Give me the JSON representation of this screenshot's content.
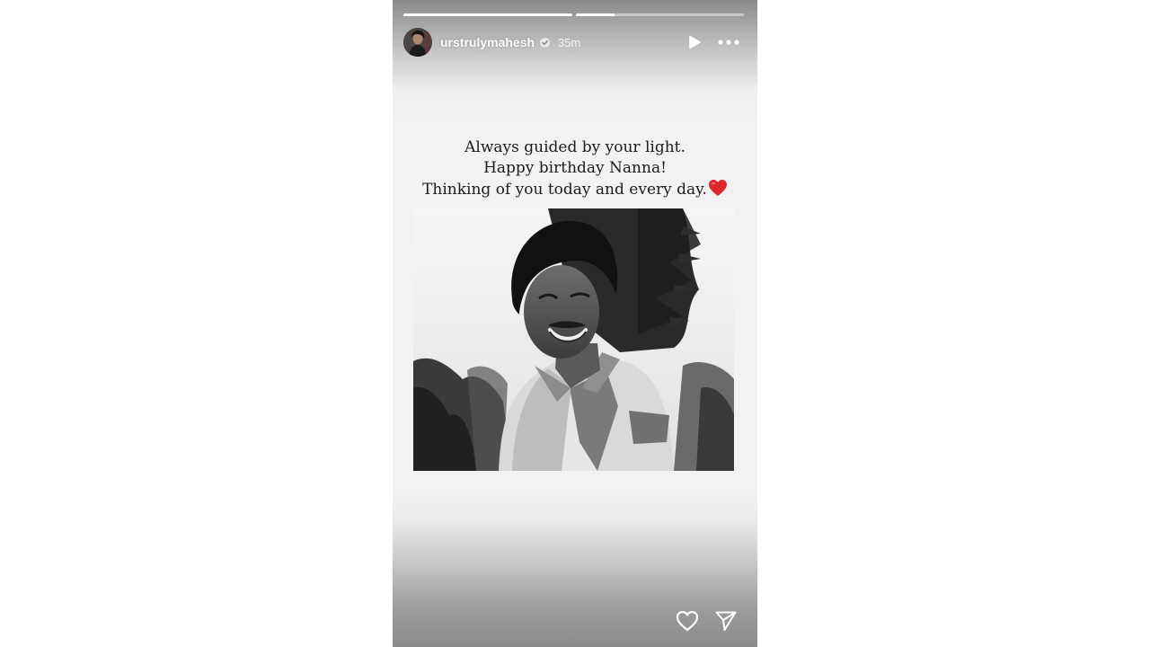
{
  "story": {
    "progress": [
      {
        "filled": 1.0
      },
      {
        "filled": 0.23
      }
    ],
    "header": {
      "username": "urstrulymahesh",
      "verified": true,
      "timestamp": "35m",
      "icons": [
        "play-icon",
        "more-options-icon"
      ]
    },
    "caption": {
      "line1": "Always guided by your light.",
      "line2": "Happy birthday Nanna!",
      "line3": "Thinking of you today and every day.",
      "emoji": "red-heart"
    },
    "photo": {
      "content": "black-and-white portrait"
    },
    "footer": {
      "icons": [
        "like-heart-icon",
        "share-send-icon"
      ]
    }
  },
  "colors": {
    "background": "#ffffff",
    "caption_text": "#1c1c1c",
    "emoji_heart": "#e0262b",
    "icon_white": "#ffffff"
  }
}
